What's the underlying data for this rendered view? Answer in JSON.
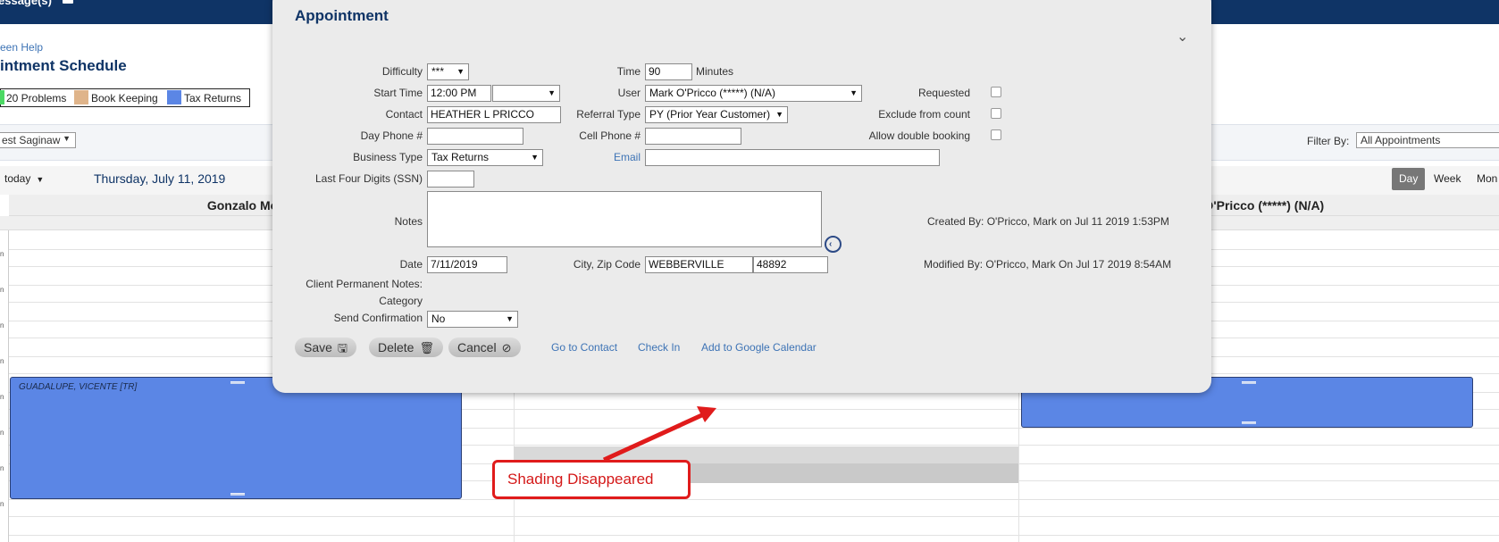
{
  "topbar": {
    "messages_label": "essage(s)"
  },
  "page": {
    "help_link": "een Help",
    "title": "intment Schedule",
    "legend": [
      {
        "label": "20 Problems",
        "color": "#4cd964"
      },
      {
        "label": "Book Keeping",
        "color": "#dfb48a"
      },
      {
        "label": "Tax Returns",
        "color": "#5b86e5"
      }
    ],
    "location_select": "est Saginaw",
    "filter_label": "Filter By:",
    "filter_value": "All Appointments",
    "today_button": "today",
    "date_label": "Thursday, July 11, 2019",
    "views": {
      "day": "Day",
      "week": "Week",
      "month": "Mon"
    }
  },
  "calendar": {
    "columns": [
      "Gonzalo Mogollon",
      "k O'Pricco (*****) (N/A)"
    ],
    "time_marker": "n",
    "appointments": [
      {
        "label": "GUADALUPE, VICENTE [TR]"
      },
      {
        "label": ""
      }
    ]
  },
  "dialog": {
    "title": "Appointment",
    "fields": {
      "difficulty_label": "Difficulty",
      "difficulty_value": "***",
      "time_label": "Time",
      "time_value": "90",
      "time_unit": "Minutes",
      "start_time_label": "Start Time",
      "start_time_value": "12:00 PM",
      "start_time_extra": "",
      "user_label": "User",
      "user_value": "Mark O'Pricco (*****) (N/A)",
      "requested_label": "Requested",
      "contact_label": "Contact",
      "contact_value": "HEATHER  L PRICCO",
      "referral_label": "Referral Type",
      "referral_value": "PY (Prior Year Customer)",
      "exclude_label": "Exclude from count",
      "day_phone_label": "Day Phone #",
      "day_phone_value": "",
      "cell_phone_label": "Cell Phone #",
      "cell_phone_value": "",
      "double_booking_label": "Allow double booking",
      "business_type_label": "Business Type",
      "business_type_value": "Tax Returns",
      "email_label": "Email",
      "email_value": "",
      "ssn_label": "Last Four Digits (SSN)",
      "ssn_value": "",
      "notes_label": "Notes",
      "created_by": "Created By: O'Pricco, Mark on Jul 11 2019 1:53PM",
      "date_label": "Date",
      "date_value": "7/11/2019",
      "city_zip_label": "City, Zip Code",
      "city_value": "WEBBERVILLE",
      "zip_value": "48892",
      "modified_by": "Modified By: O'Pricco, Mark On Jul 17 2019 8:54AM",
      "client_notes_label": "Client Permanent Notes:",
      "category_label": "Category",
      "send_confirmation_label": "Send Confirmation",
      "send_confirmation_value": "No"
    },
    "buttons": {
      "save": "Save",
      "delete": "Delete",
      "cancel": "Cancel"
    },
    "links": {
      "go_to_contact": "Go to Contact",
      "check_in": "Check In",
      "google": "Add to Google Calendar"
    }
  },
  "annotation": {
    "callout_text": "Shading Disappeared"
  },
  "colors": {
    "accent": "#0f3466",
    "appointment": "#5b86e5",
    "annotation": "#e01b1b"
  }
}
